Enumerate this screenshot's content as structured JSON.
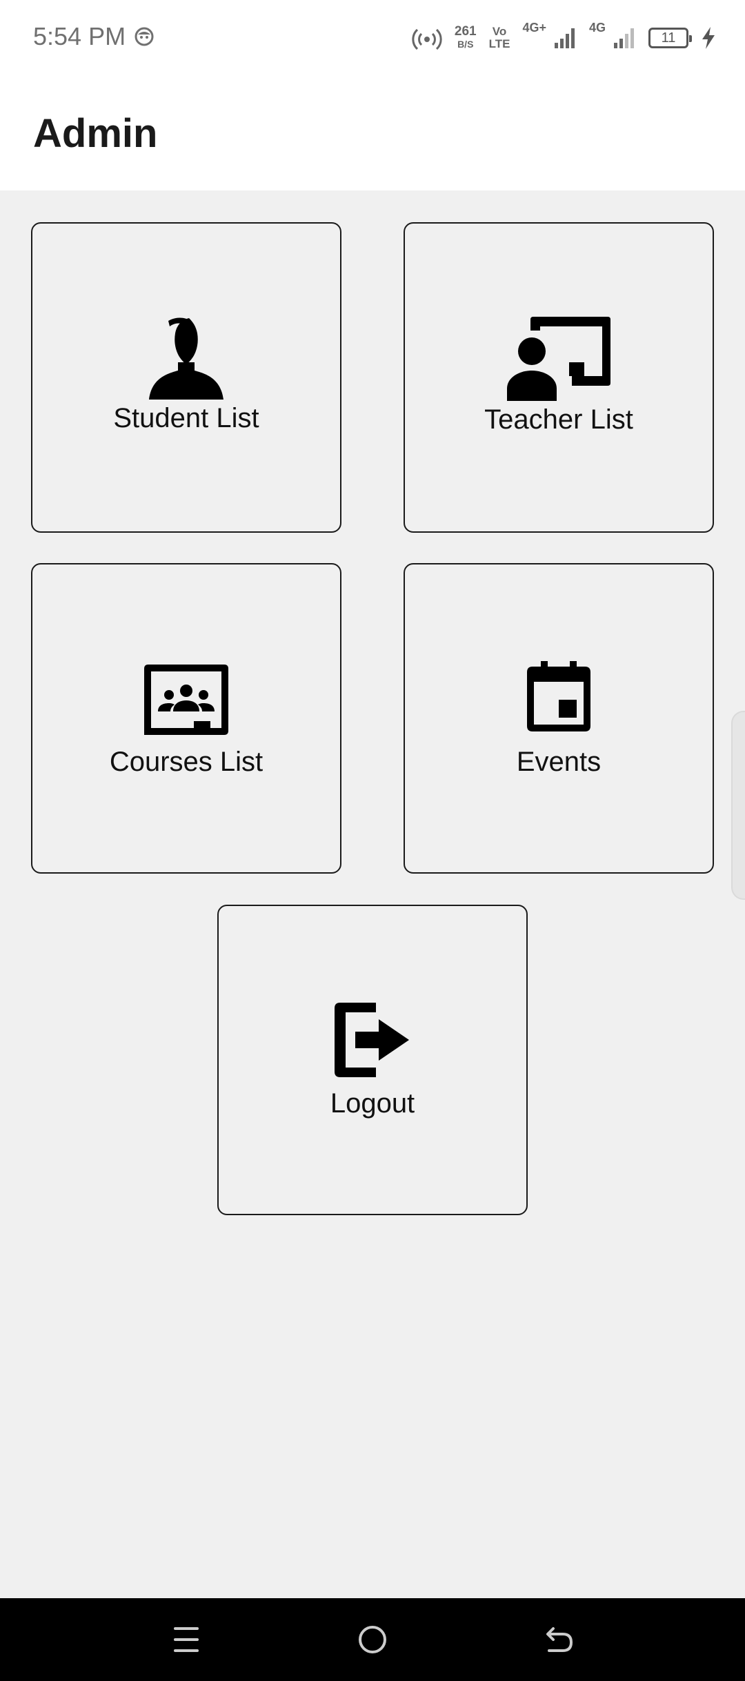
{
  "status_bar": {
    "time": "5:54 PM",
    "network_speed_value": "261",
    "network_speed_unit": "B/S",
    "volte_top": "Vo",
    "volte_bottom": "LTE",
    "signal1_label": "4G+",
    "signal2_label": "4G",
    "battery_level": "11",
    "icons": [
      "face-icon",
      "hotspot-icon",
      "signal-icon",
      "signal-icon",
      "battery-icon",
      "charging-bolt-icon"
    ]
  },
  "app_bar": {
    "title": "Admin"
  },
  "menu": {
    "student_list": {
      "label": "Student List",
      "icon": "student-person-icon"
    },
    "teacher_list": {
      "label": "Teacher List",
      "icon": "teacher-board-icon"
    },
    "courses_list": {
      "label": "Courses List",
      "icon": "classroom-icon"
    },
    "events": {
      "label": "Events",
      "icon": "calendar-event-icon"
    },
    "logout": {
      "label": "Logout",
      "icon": "logout-icon"
    }
  },
  "nav_bar": {
    "icons": [
      "menu-icon",
      "home-icon",
      "back-icon"
    ]
  },
  "colors": {
    "background": "#f0f0f0",
    "app_bar": "#ffffff",
    "card_border": "#1a1a1a",
    "nav_bar": "#000000"
  }
}
